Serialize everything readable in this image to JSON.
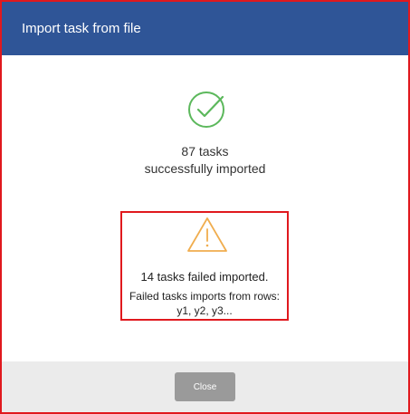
{
  "dialog": {
    "title": "Import task from file",
    "success": {
      "icon": "check-circle-icon",
      "color": "#5cb85c",
      "line1": "87 tasks",
      "line2": "successfully imported"
    },
    "errors": {
      "icon": "warning-triangle-icon",
      "color": "#f0ad4e",
      "summary": "14 tasks failed imported.",
      "detail_line1": "Failed tasks imports from rows:",
      "detail_line2": "y1, y2, y3..."
    },
    "close_label": "Close"
  },
  "colors": {
    "header": "#2f5597",
    "highlight_border": "#e0191e",
    "footer": "#ebebeb",
    "button": "#9a9a9a"
  }
}
